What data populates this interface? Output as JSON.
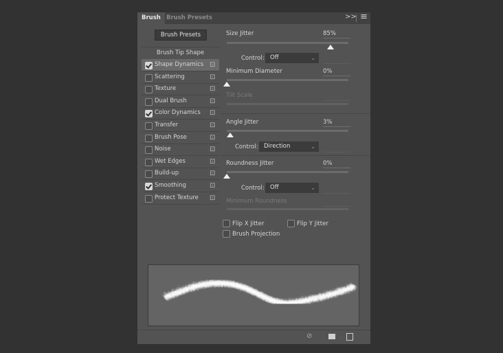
{
  "tabs": [
    {
      "label": "Brush",
      "active": true
    },
    {
      "label": "Brush Presets",
      "active": false
    }
  ],
  "tab_icons": {
    "expand": "double-chevron-right-icon",
    "menu": "hamburger-menu-icon",
    "expand_glyph": ">>",
    "menu_glyph": "≡"
  },
  "brush_presets_button": "Brush Presets",
  "brush_tip_shape": "Brush Tip Shape",
  "options": [
    {
      "label": "Shape Dynamics",
      "checked": true,
      "selected": true
    },
    {
      "label": "Scattering",
      "checked": false
    },
    {
      "label": "Texture",
      "checked": false
    },
    {
      "label": "Dual Brush",
      "checked": false
    },
    {
      "label": "Color Dynamics",
      "checked": true
    },
    {
      "label": "Transfer",
      "checked": false
    },
    {
      "label": "Brush Pose",
      "checked": false
    },
    {
      "label": "Noise",
      "checked": false
    },
    {
      "label": "Wet Edges",
      "checked": false
    },
    {
      "label": "Build-up",
      "checked": false
    },
    {
      "label": "Smoothing",
      "checked": true
    },
    {
      "label": "Protect Texture",
      "checked": false
    }
  ],
  "settings": {
    "size_jitter": {
      "label": "Size Jitter",
      "value": "85%",
      "percent": 85
    },
    "size_control": {
      "label": "Control:",
      "value": "Off"
    },
    "min_diameter": {
      "label": "Minimum Diameter",
      "value": "0%",
      "percent": 0
    },
    "tilt_scale": {
      "label": "Tilt Scale"
    },
    "angle_jitter": {
      "label": "Angle Jitter",
      "value": "3%",
      "percent": 3
    },
    "angle_control": {
      "label": "Control:",
      "value": "Direction"
    },
    "roundness_jitter": {
      "label": "Roundness Jitter",
      "value": "0%",
      "percent": 0
    },
    "roundness_control": {
      "label": "Control:",
      "value": "Off"
    },
    "min_roundness": {
      "label": "Minimum Roundness"
    },
    "flip_x": {
      "label": "Flip X Jitter",
      "checked": false
    },
    "flip_y": {
      "label": "Flip Y Jitter",
      "checked": false
    },
    "brush_projection": {
      "label": "Brush Projection",
      "checked": false
    }
  },
  "footer_icons": [
    "toggle-live-tip-preview-icon",
    "grid-preview-icon",
    "create-new-brush-icon"
  ]
}
